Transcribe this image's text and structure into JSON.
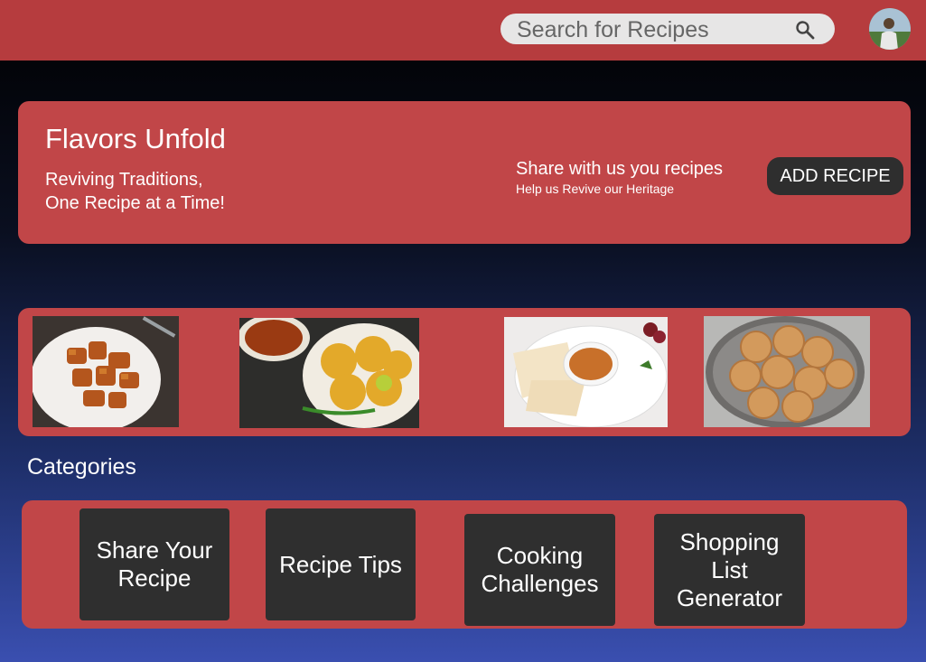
{
  "header": {
    "search_placeholder": "Search for Recipes",
    "search_icon": "search-icon",
    "avatar_icon": "user-avatar"
  },
  "hero": {
    "title": "Flavors Unfold",
    "subtitle_line1": "Reviving Traditions,",
    "subtitle_line2": "One Recipe at a Time!",
    "share_text": "Share with us you recipes",
    "help_text": "Help us Revive our Heritage",
    "add_button_label": "ADD RECIPE"
  },
  "gallery": {
    "images": [
      "fried-dish-photo",
      "puri-chana-photo",
      "papad-curry-photo",
      "round-snack-photo"
    ]
  },
  "categories": {
    "title": "Categories",
    "items": [
      {
        "label": "Share Your\nRecipe"
      },
      {
        "label": "Recipe Tips"
      },
      {
        "label": "Cooking\nChallenges"
      },
      {
        "label": "Shopping\nList\nGenerator"
      }
    ]
  },
  "colors": {
    "primary_red": "#c14648",
    "topbar_red": "#b63c3e",
    "button_dark": "#2f2f2f"
  }
}
